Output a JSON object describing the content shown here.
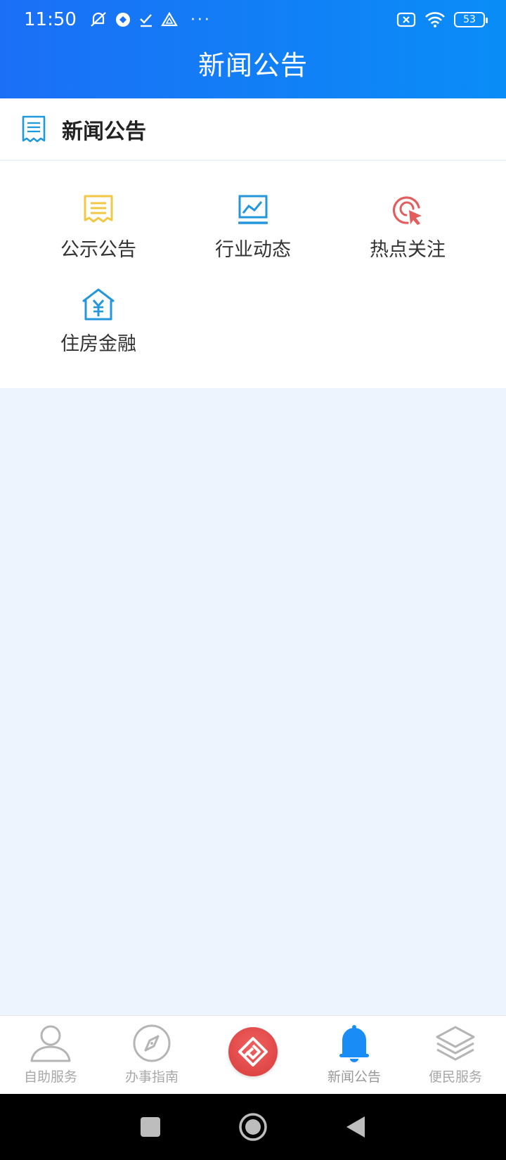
{
  "status_bar": {
    "time": "11:50",
    "more": "···",
    "battery": "53"
  },
  "header": {
    "title": "新闻公告"
  },
  "section": {
    "title": "新闻公告"
  },
  "grid": {
    "items": [
      {
        "label": "公示公告",
        "icon": "notice-icon",
        "color": "#f2c744"
      },
      {
        "label": "行业动态",
        "icon": "chart-icon",
        "color": "#2496dc"
      },
      {
        "label": "热点关注",
        "icon": "target-cursor-icon",
        "color": "#e45d5d"
      },
      {
        "label": "住房金融",
        "icon": "house-yuan-icon",
        "color": "#2496dc"
      }
    ]
  },
  "bottom_nav": {
    "items": [
      {
        "label": "自助服务",
        "icon": "user-icon"
      },
      {
        "label": "办事指南",
        "icon": "compass-icon"
      },
      {
        "label": "",
        "icon": "home-logo-icon"
      },
      {
        "label": "新闻公告",
        "icon": "bell-icon",
        "active": true
      },
      {
        "label": "便民服务",
        "icon": "layers-icon"
      }
    ],
    "active_color": "#1a8cf5",
    "inactive_color": "#a8a8a8"
  }
}
